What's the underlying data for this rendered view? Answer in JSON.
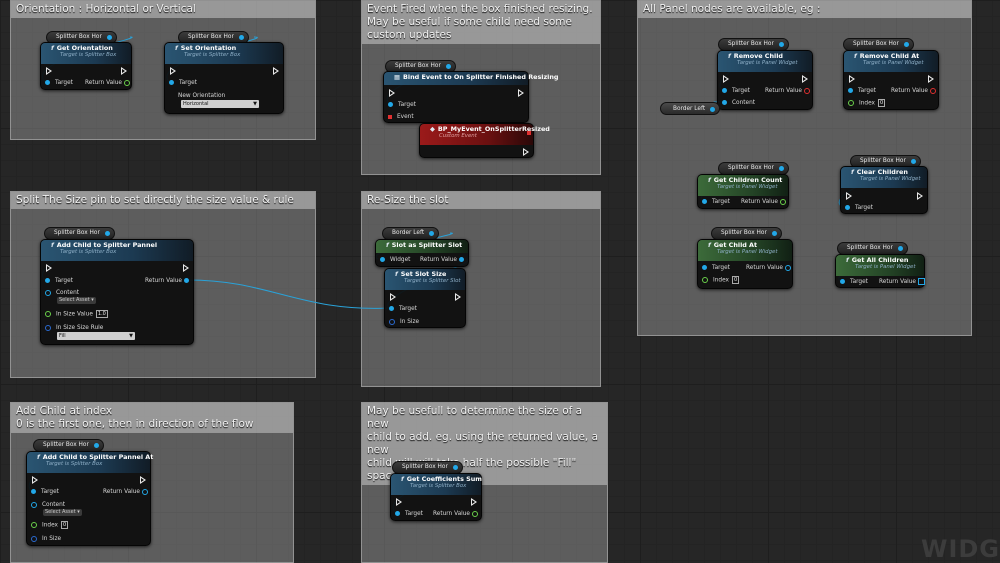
{
  "comments": {
    "orientation": {
      "title": "Orientation : Horizontal or Vertical"
    },
    "event_fired": {
      "title": "Event Fired when the box finished resizing.\nMay be useful if some child need some\ncustom updates"
    },
    "all_panel": {
      "title": "All Panel nodes are available, eg :"
    },
    "split_size": {
      "title": "Split The Size pin to set directly the size value & rule"
    },
    "resize_slot": {
      "title": "Re-Size the slot"
    },
    "add_child_index": {
      "title": "Add Child at index\n0 is the first one, then in direction of the flow"
    },
    "coefficients": {
      "title": "May be usefull to determine the size of a new\nchild to add. eg. using the returned value, a new\nchild will will take half the possible \"Fill\" space."
    }
  },
  "vars": {
    "splitter": "Splitter Box Hor",
    "border_left": "Border Left"
  },
  "pins": {
    "target": "Target",
    "return_value": "Return Value",
    "content": "Content",
    "index": "Index",
    "widget": "Widget",
    "event": "Event",
    "in_size": "In Size",
    "in_size_value": "In Size Value",
    "in_size_rule": "In Size Size Rule",
    "new_orientation": "New Orientation",
    "select_asset": "Select Asset"
  },
  "nodes": {
    "get_orientation": {
      "title": "Get Orientation",
      "sub": "Target is Splitter Box"
    },
    "set_orientation": {
      "title": "Set Orientation",
      "sub": "Target is Splitter Box",
      "dropdown": "Horizontal"
    },
    "bind_event": {
      "title": "Bind Event to On Splitter Finished Resizing"
    },
    "custom_event": {
      "title": "BP_MyEvent_OnSplitterResized",
      "sub": "Custom Event"
    },
    "add_child_pannel": {
      "title": "Add Child to Splitter Pannel",
      "sub": "Target is Splitter Box",
      "size_value": "1.0",
      "rule": "Fill"
    },
    "slot_as_splitter": {
      "title": "Slot as Splitter Slot"
    },
    "set_slot_size": {
      "title": "Set Slot Size",
      "sub": "Target is Splitter Slot"
    },
    "add_child_at": {
      "title": "Add Child to Splitter Pannel At",
      "sub": "Target is Splitter Box",
      "index": "0"
    },
    "coefficients_sum": {
      "title": "Get Coefficients Sum",
      "sub": "Target is Splitter Box"
    },
    "remove_child": {
      "title": "Remove Child",
      "sub": "Target is Panel Widget"
    },
    "remove_child_at": {
      "title": "Remove Child At",
      "sub": "Target is Panel Widget",
      "index": "0"
    },
    "get_children_count": {
      "title": "Get Children Count",
      "sub": "Target is Panel Widget"
    },
    "clear_children": {
      "title": "Clear Children",
      "sub": "Target is Panel Widget"
    },
    "get_child_at": {
      "title": "Get Child At",
      "sub": "Target is Panel Widget",
      "index": "0"
    },
    "get_all_children": {
      "title": "Get All Children",
      "sub": "Target is Panel Widget"
    }
  },
  "watermark": "WIDG",
  "colors": {
    "object_pin": "#22a8e8",
    "int_pin": "#6ad04a",
    "exec_pin": "#e8e8e8",
    "event_node": "#9b1a1a",
    "pure_node": "#3c6b3a",
    "function_node": "#2a5572"
  }
}
